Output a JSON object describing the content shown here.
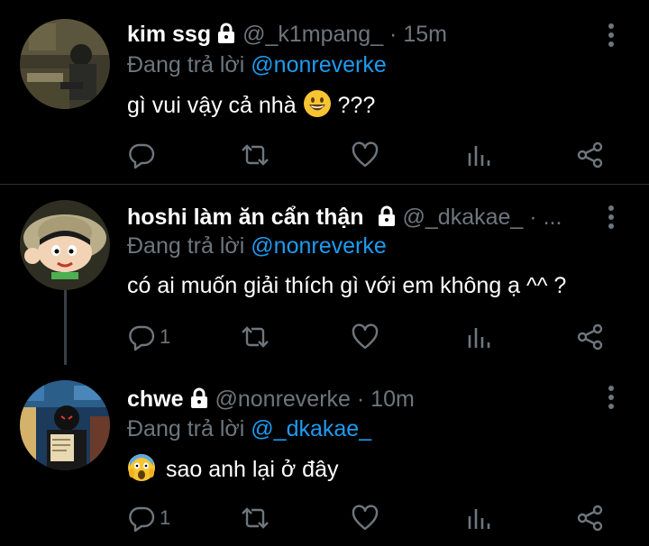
{
  "tweets": [
    {
      "name": "kim ssg",
      "handle": "@_k1mpang_",
      "separator": "·",
      "time": "15m",
      "replying_prefix": "Đang trả lời",
      "replying_to": "@nonreverke",
      "text": "gì vui vậy cả nhà",
      "text_suffix": "???",
      "reply_count": "",
      "emoji": "grinning-face"
    },
    {
      "name": "hoshi làm ăn cẩn thận",
      "handle": "@_dkakae_",
      "separator": "·",
      "time": "...",
      "replying_prefix": "Đang trả lời",
      "replying_to": "@nonreverke",
      "text": "có ai muốn giải thích gì với em không ạ ^^ ?",
      "reply_count": "1"
    },
    {
      "name": "chwe",
      "handle": "@nonreverke",
      "separator": "·",
      "time": "10m",
      "replying_prefix": "Đang trả lời",
      "replying_to": "@_dkakae_",
      "text": "sao anh lại ở đây",
      "reply_count": "1",
      "emoji": "face-screaming-in-fear"
    }
  ],
  "colors": {
    "background": "#000000",
    "secondary_text": "#6e767d",
    "link": "#1d9bf0",
    "divider": "#2f3336"
  },
  "icons": [
    "reply-icon",
    "retweet-icon",
    "like-icon",
    "stats-icon",
    "share-icon",
    "lock-icon",
    "more-icon"
  ]
}
